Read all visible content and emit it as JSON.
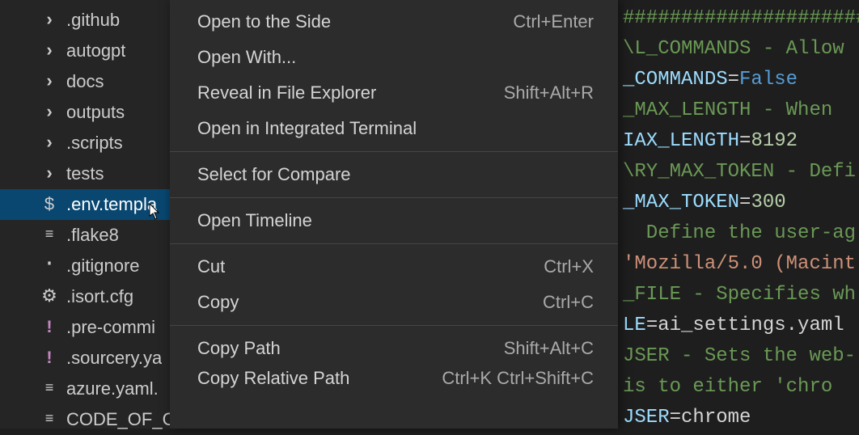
{
  "explorer": {
    "items": [
      {
        "icon": "chevron-right",
        "label": ".github"
      },
      {
        "icon": "chevron-right",
        "label": "autogpt"
      },
      {
        "icon": "chevron-right",
        "label": "docs"
      },
      {
        "icon": "chevron-right",
        "label": "outputs"
      },
      {
        "icon": "chevron-right",
        "label": ".scripts"
      },
      {
        "icon": "chevron-right",
        "label": "tests"
      },
      {
        "icon": "dollar",
        "label": ".env.templa",
        "selected": true
      },
      {
        "icon": "lines",
        "label": ".flake8"
      },
      {
        "icon": "dot",
        "label": ".gitignore"
      },
      {
        "icon": "gear",
        "label": ".isort.cfg"
      },
      {
        "icon": "excl",
        "label": ".pre-commi"
      },
      {
        "icon": "excl",
        "label": ".sourcery.ya"
      },
      {
        "icon": "lines",
        "label": "azure.yaml."
      },
      {
        "icon": "lines",
        "label": "CODE_OF_C"
      }
    ]
  },
  "context_menu": {
    "groups": [
      [
        {
          "label": "Open to the Side",
          "shortcut": "Ctrl+Enter"
        },
        {
          "label": "Open With...",
          "shortcut": ""
        },
        {
          "label": "Reveal in File Explorer",
          "shortcut": "Shift+Alt+R"
        },
        {
          "label": "Open in Integrated Terminal",
          "shortcut": ""
        }
      ],
      [
        {
          "label": "Select for Compare",
          "shortcut": ""
        }
      ],
      [
        {
          "label": "Open Timeline",
          "shortcut": ""
        }
      ],
      [
        {
          "label": "Cut",
          "shortcut": "Ctrl+X"
        },
        {
          "label": "Copy",
          "shortcut": "Ctrl+C"
        }
      ],
      [
        {
          "label": "Copy Path",
          "shortcut": "Shift+Alt+C"
        },
        {
          "label": "Copy Relative Path",
          "shortcut": "Ctrl+K Ctrl+Shift+C"
        }
      ]
    ]
  },
  "editor": {
    "lines": [
      [
        {
          "cls": "c-comment",
          "text": "#####################"
        }
      ],
      [
        {
          "cls": "c-comment",
          "text": "\\L_COMMANDS - Allow "
        }
      ],
      [
        {
          "cls": "c-key",
          "text": "_COMMANDS"
        },
        {
          "cls": "c-eq",
          "text": "="
        },
        {
          "cls": "c-bool",
          "text": "False"
        }
      ],
      [
        {
          "cls": "c-comment",
          "text": "_MAX_LENGTH - When "
        }
      ],
      [
        {
          "cls": "c-key",
          "text": "IAX_LENGTH"
        },
        {
          "cls": "c-eq",
          "text": "="
        },
        {
          "cls": "c-num",
          "text": "8192"
        }
      ],
      [
        {
          "cls": "c-comment",
          "text": "\\RY_MAX_TOKEN - Defi"
        }
      ],
      [
        {
          "cls": "c-key",
          "text": "_MAX_TOKEN"
        },
        {
          "cls": "c-eq",
          "text": "="
        },
        {
          "cls": "c-num",
          "text": "300"
        }
      ],
      [
        {
          "cls": "c-comment",
          "text": "  Define the user-ag"
        }
      ],
      [
        {
          "cls": "c-value",
          "text": "'Mozilla/5.0 (Macint"
        }
      ],
      [
        {
          "cls": "c-comment",
          "text": "_FILE - Specifies wh"
        }
      ],
      [
        {
          "cls": "c-key",
          "text": "LE"
        },
        {
          "cls": "c-eq",
          "text": "="
        },
        {
          "cls": "c-plain",
          "text": "ai_settings.yaml"
        }
      ],
      [
        {
          "cls": "c-comment",
          "text": "JSER - Sets the web-"
        }
      ],
      [
        {
          "cls": "c-comment",
          "text": "is to either 'chro"
        }
      ],
      [
        {
          "cls": "c-key",
          "text": "JSER"
        },
        {
          "cls": "c-eq",
          "text": "="
        },
        {
          "cls": "c-plain",
          "text": "chrome"
        }
      ]
    ]
  }
}
